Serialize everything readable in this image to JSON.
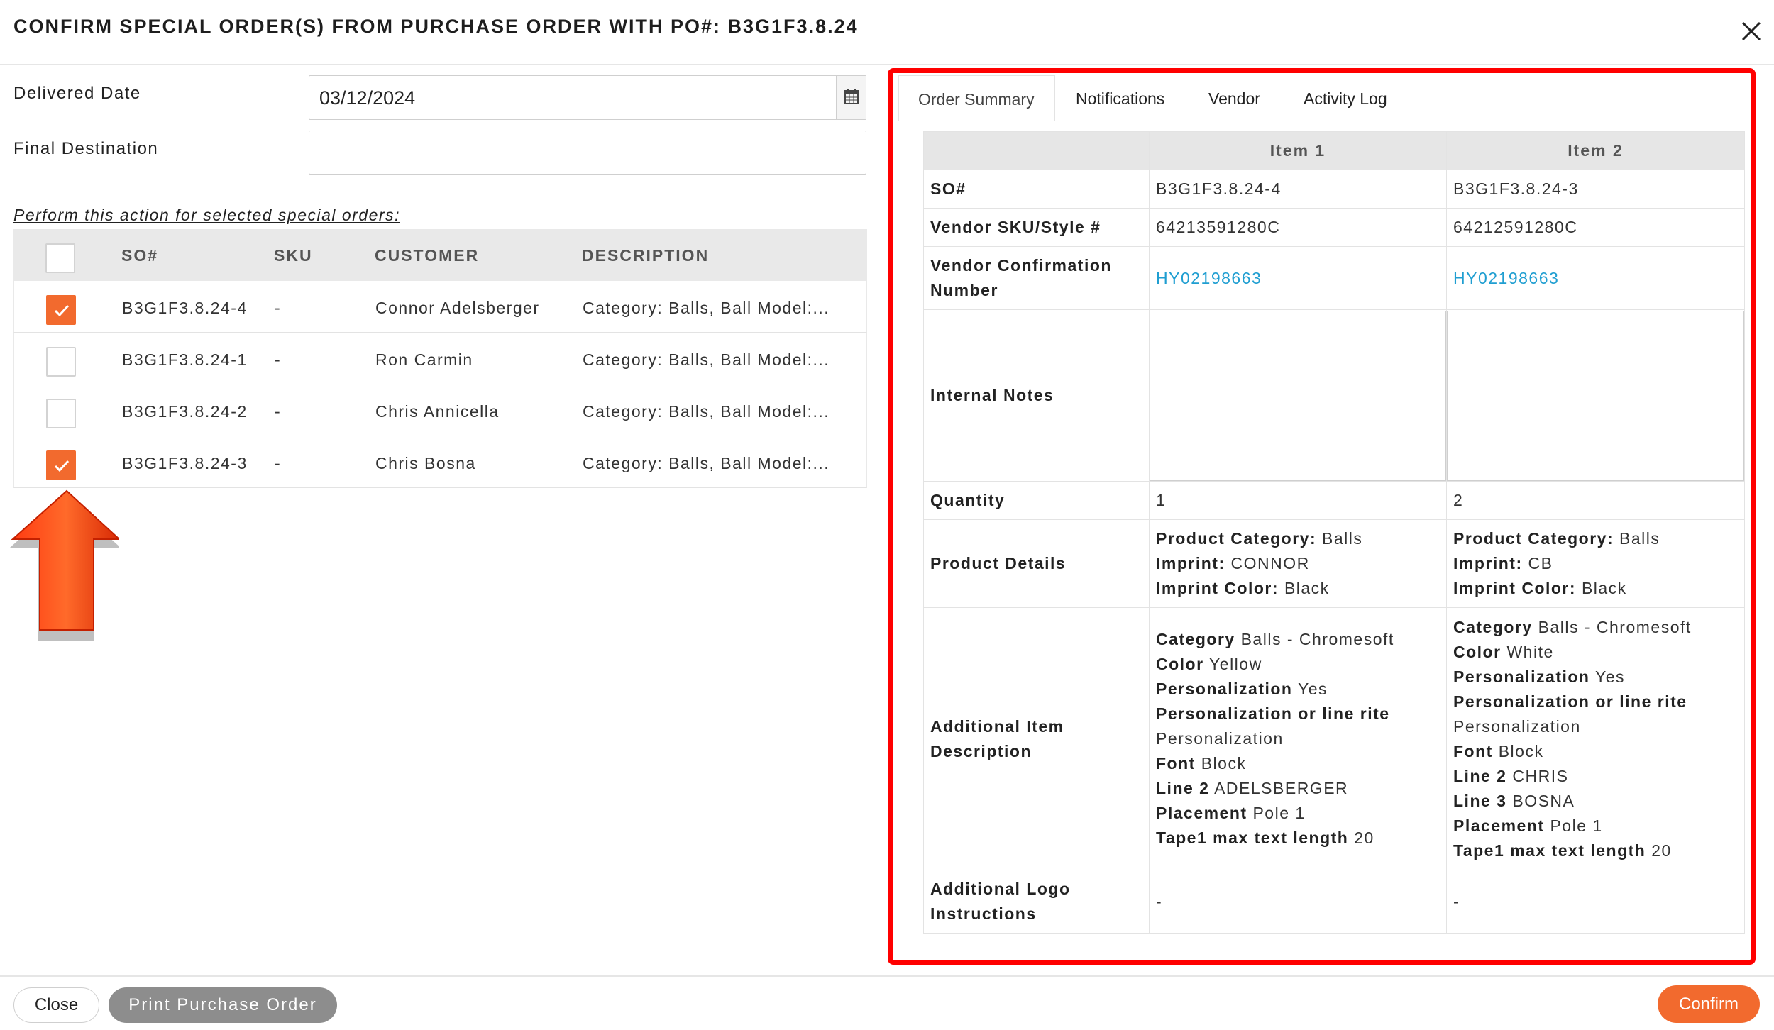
{
  "header": {
    "title": "CONFIRM SPECIAL ORDER(S) FROM PURCHASE ORDER WITH PO#: B3G1F3.8.24"
  },
  "form": {
    "delivered_label": "Delivered Date",
    "delivered_value": "03/12/2024",
    "final_label": "Final Destination",
    "final_value": ""
  },
  "perform_text": "Perform this action for selected special orders:",
  "so_table": {
    "headers": [
      "SO#",
      "SKU",
      "CUSTOMER",
      "DESCRIPTION"
    ],
    "rows": [
      {
        "checked": true,
        "so": "B3G1F3.8.24-4",
        "sku": "-",
        "customer": "Connor Adelsberger",
        "description": "Category: Balls, Ball Model:..."
      },
      {
        "checked": false,
        "so": "B3G1F3.8.24-1",
        "sku": "-",
        "customer": "Ron Carmin",
        "description": "Category: Balls, Ball Model:..."
      },
      {
        "checked": false,
        "so": "B3G1F3.8.24-2",
        "sku": "-",
        "customer": "Chris Annicella",
        "description": "Category: Balls, Ball Model:..."
      },
      {
        "checked": true,
        "so": "B3G1F3.8.24-3",
        "sku": "-",
        "customer": "Chris Bosna",
        "description": "Category: Balls, Ball Model:..."
      }
    ]
  },
  "tabs": [
    "Order Summary",
    "Notifications",
    "Vendor",
    "Activity Log"
  ],
  "summary": {
    "item_headers": [
      "Item 1",
      "Item 2"
    ],
    "labels": {
      "so": "SO#",
      "vendor_sku": "Vendor SKU/Style #",
      "vendor_conf": "Vendor Confirmation Number",
      "internal_notes": "Internal Notes",
      "quantity": "Quantity",
      "product_details": "Product Details",
      "additional_desc": "Additional Item Description",
      "logo_instructions": "Additional Logo Instructions"
    },
    "items": [
      {
        "so": "B3G1F3.8.24-4",
        "vendor_sku": "64213591280C",
        "vendor_conf": "HY02198663",
        "quantity": "1",
        "product_details": [
          {
            "k": "Product Category:",
            "v": "Balls"
          },
          {
            "k": "Imprint:",
            "v": "CONNOR"
          },
          {
            "k": "Imprint Color:",
            "v": "Black"
          }
        ],
        "additional_desc": [
          {
            "k": "Category",
            "v": "Balls - Chromesoft"
          },
          {
            "k": "Color",
            "v": "Yellow"
          },
          {
            "k": "Personalization",
            "v": "Yes"
          },
          {
            "k": "Personalization or line rite",
            "v": ""
          },
          {
            "k": "",
            "v": "Personalization"
          },
          {
            "k": "Font",
            "v": "Block"
          },
          {
            "k": "Line 2",
            "v": "ADELSBERGER"
          },
          {
            "k": "Placement",
            "v": "Pole 1"
          },
          {
            "k": "Tape1 max text length",
            "v": "20"
          }
        ],
        "logo_instructions": "-"
      },
      {
        "so": "B3G1F3.8.24-3",
        "vendor_sku": "64212591280C",
        "vendor_conf": "HY02198663",
        "quantity": "2",
        "product_details": [
          {
            "k": "Product Category:",
            "v": "Balls"
          },
          {
            "k": "Imprint:",
            "v": "CB"
          },
          {
            "k": "Imprint Color:",
            "v": "Black"
          }
        ],
        "additional_desc": [
          {
            "k": "Category",
            "v": "Balls - Chromesoft"
          },
          {
            "k": "Color",
            "v": "White"
          },
          {
            "k": "Personalization",
            "v": "Yes"
          },
          {
            "k": "Personalization or line rite",
            "v": ""
          },
          {
            "k": "",
            "v": "Personalization"
          },
          {
            "k": "Font",
            "v": "Block"
          },
          {
            "k": "Line 2",
            "v": "CHRIS"
          },
          {
            "k": "Line 3",
            "v": "BOSNA"
          },
          {
            "k": "Placement",
            "v": "Pole 1"
          },
          {
            "k": "Tape1 max text length",
            "v": "20"
          }
        ],
        "logo_instructions": "-"
      }
    ]
  },
  "footer": {
    "close_label": "Close",
    "print_label": "Print Purchase Order",
    "confirm_label": "Confirm"
  },
  "colors": {
    "accent": "#f26a2e",
    "link": "#1f9ed1",
    "highlight": "#ff0000",
    "print_button": "#8d8d8d"
  },
  "icons": {
    "close": "close-icon",
    "calendar": "calendar-icon",
    "check": "check-icon",
    "arrow": "arrow-up-icon"
  }
}
